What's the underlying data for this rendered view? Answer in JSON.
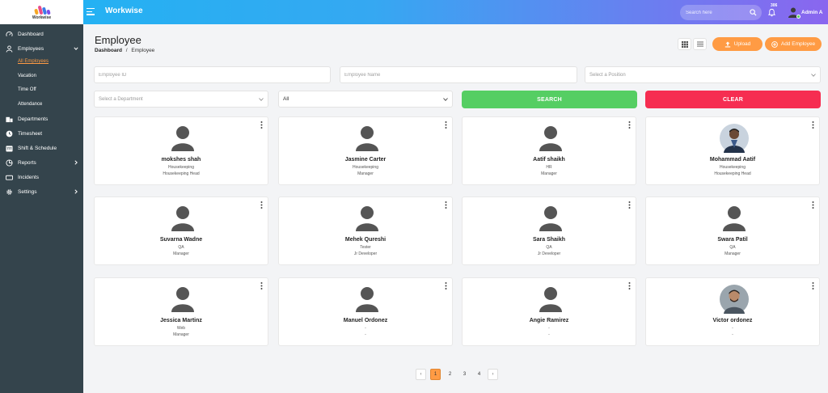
{
  "app": {
    "logo_text": "Workwise",
    "title": "Workwise"
  },
  "topbar": {
    "search_placeholder": "Search here",
    "notification_count": "306",
    "user_name": "Admin A"
  },
  "sidebar": {
    "items": [
      {
        "label": "Dashboard",
        "icon": "dashboard-icon"
      },
      {
        "label": "Employees",
        "icon": "user-icon",
        "expanded": true
      },
      {
        "label": "Departments",
        "icon": "departments-icon"
      },
      {
        "label": "Timesheet",
        "icon": "clock-icon"
      },
      {
        "label": "Shift & Schedule",
        "icon": "calendar-icon"
      },
      {
        "label": "Reports",
        "icon": "reports-icon"
      },
      {
        "label": "Incidents",
        "icon": "incidents-icon"
      },
      {
        "label": "Settings",
        "icon": "gear-icon"
      }
    ],
    "employee_subitems": [
      "All Employees",
      "Vacation",
      "Time Off",
      "Attendance"
    ]
  },
  "page": {
    "title": "Employee",
    "breadcrumb": {
      "parent": "Dashboard",
      "separator": "/",
      "current": "Employee"
    },
    "upload_label": "Upload",
    "add_label": "Add Employee"
  },
  "filters": {
    "employee_id_placeholder": "Employee ID",
    "employee_name_placeholder": "Employee Name",
    "position_placeholder": "Select a Position",
    "department_placeholder": "Select a Department",
    "status_value": "All",
    "search_label": "SEARCH",
    "clear_label": "CLEAR"
  },
  "employees": [
    {
      "name": "mokshes shah",
      "department": "Housekeeping",
      "designation": "Housekeeping Head",
      "photo": "default-avatar"
    },
    {
      "name": "Jasmine Carter",
      "department": "Housekeeping",
      "designation": "Manager",
      "photo": "default-avatar"
    },
    {
      "name": "Aatif shaikh",
      "department": "HR",
      "designation": "Manager",
      "photo": "default-avatar"
    },
    {
      "name": "Mohammad Aatif",
      "department": "Housekeeping",
      "designation": "Housekeeping Head",
      "photo": "photo"
    },
    {
      "name": "Suvarna Wadne",
      "department": "QA",
      "designation": "Manager",
      "photo": "default-avatar"
    },
    {
      "name": "Mehek Qureshi",
      "department": "Tester",
      "designation": "Jr Developer",
      "photo": "default-avatar"
    },
    {
      "name": "Sara Shaikh",
      "department": "QA",
      "designation": "Jr Developer",
      "photo": "default-avatar"
    },
    {
      "name": "Swara Patil",
      "department": "QA",
      "designation": "Manager",
      "photo": "default-avatar"
    },
    {
      "name": "Jessica Martinz",
      "department": "Web",
      "designation": "Manager",
      "photo": "default-avatar"
    },
    {
      "name": "Manuel Ordonez",
      "department": "-",
      "designation": "-",
      "photo": "default-avatar"
    },
    {
      "name": "Angie Ramirez",
      "department": "-",
      "designation": "-",
      "photo": "default-avatar"
    },
    {
      "name": "Victor ordonez",
      "department": "-",
      "designation": "-",
      "photo": "photo"
    }
  ],
  "pagination": {
    "prev": "‹",
    "pages": [
      "1",
      "2",
      "3",
      "4"
    ],
    "current": "1",
    "next": "›"
  },
  "colors": {
    "accent": "#ff9b44",
    "search_button": "#55ce63",
    "clear_button": "#f62d51",
    "sidebar": "#34444c"
  }
}
